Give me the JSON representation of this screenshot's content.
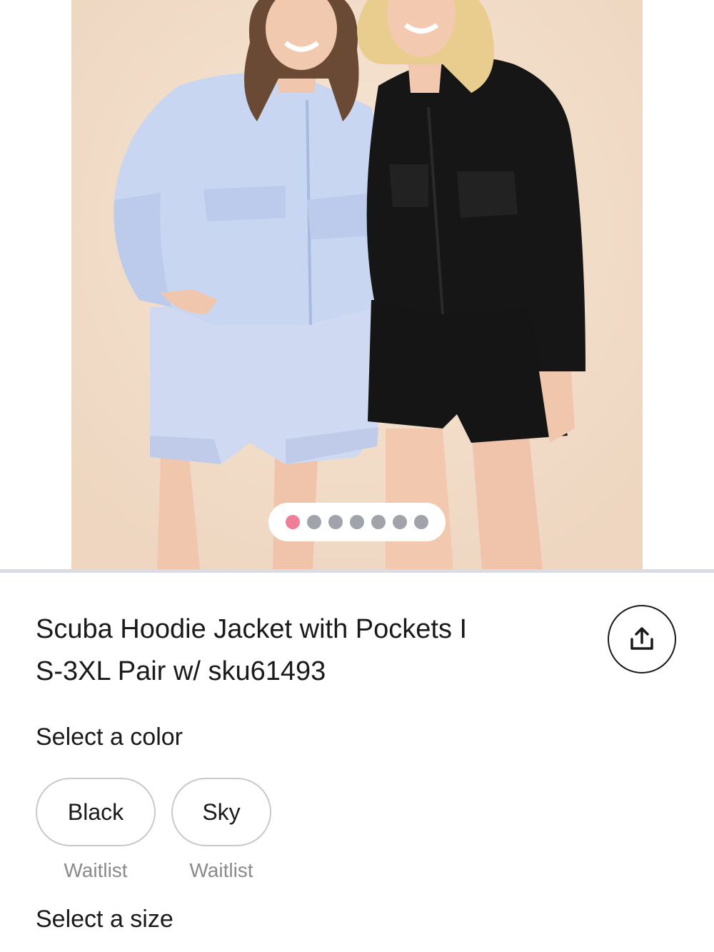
{
  "product": {
    "title_line1": "Scuba Hoodie Jacket with Pockets I",
    "title_line2": "S-3XL Pair w/ sku61493"
  },
  "gallery": {
    "image_count": 7,
    "active_index": 0,
    "colors": {
      "active_dot": "#ef7f98",
      "inactive_dot": "#a0a3aa",
      "backdrop": "#f2ddc9"
    }
  },
  "share": {
    "icon": "share-upload-icon"
  },
  "color_selector": {
    "label": "Select a color",
    "options": [
      {
        "name": "Black",
        "status": "Waitlist"
      },
      {
        "name": "Sky",
        "status": "Waitlist"
      }
    ]
  },
  "size_selector": {
    "label": "Select a size"
  }
}
